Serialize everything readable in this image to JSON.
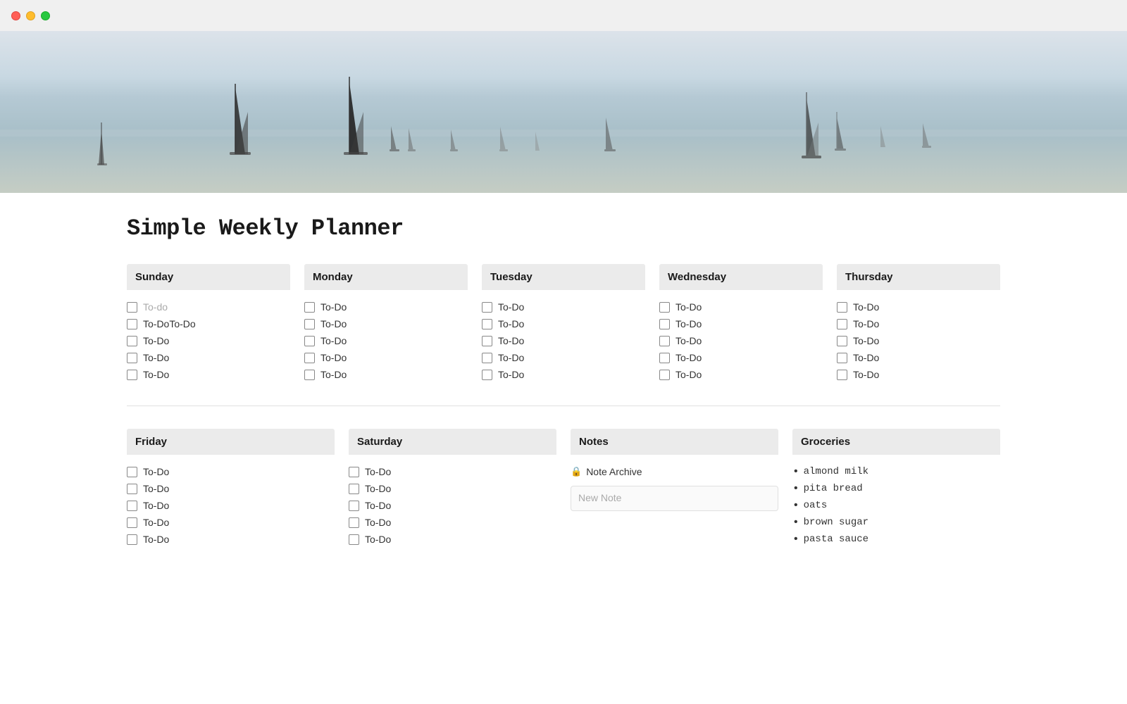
{
  "titlebar": {
    "lights": [
      "red",
      "yellow",
      "green"
    ]
  },
  "page": {
    "title": "Simple Weekly Planner"
  },
  "days": [
    {
      "name": "Sunday",
      "items": [
        {
          "text": "To-do",
          "placeholder": true
        },
        {
          "text": "To-DoTo-Do",
          "placeholder": false
        },
        {
          "text": "To-Do",
          "placeholder": false
        },
        {
          "text": "To-Do",
          "placeholder": false
        },
        {
          "text": "To-Do",
          "placeholder": false
        }
      ]
    },
    {
      "name": "Monday",
      "items": [
        {
          "text": "To-Do",
          "placeholder": false
        },
        {
          "text": "To-Do",
          "placeholder": false
        },
        {
          "text": "To-Do",
          "placeholder": false
        },
        {
          "text": "To-Do",
          "placeholder": false
        },
        {
          "text": "To-Do",
          "placeholder": false
        }
      ]
    },
    {
      "name": "Tuesday",
      "items": [
        {
          "text": "To-Do",
          "placeholder": false
        },
        {
          "text": "To-Do",
          "placeholder": false
        },
        {
          "text": "To-Do",
          "placeholder": false
        },
        {
          "text": "To-Do",
          "placeholder": false
        },
        {
          "text": "To-Do",
          "placeholder": false
        }
      ]
    },
    {
      "name": "Wednesday",
      "items": [
        {
          "text": "To-Do",
          "placeholder": false
        },
        {
          "text": "To-Do",
          "placeholder": false
        },
        {
          "text": "To-Do",
          "placeholder": false
        },
        {
          "text": "To-Do",
          "placeholder": false
        },
        {
          "text": "To-Do",
          "placeholder": false
        }
      ]
    },
    {
      "name": "Thursday",
      "items": [
        {
          "text": "To-Do",
          "placeholder": false
        },
        {
          "text": "To-Do",
          "placeholder": false
        },
        {
          "text": "To-Do",
          "placeholder": false
        },
        {
          "text": "To-Do",
          "placeholder": false
        },
        {
          "text": "To-Do",
          "placeholder": false
        }
      ]
    }
  ],
  "bottom_days": [
    {
      "name": "Friday",
      "items": [
        {
          "text": "To-Do"
        },
        {
          "text": "To-Do"
        },
        {
          "text": "To-Do"
        },
        {
          "text": "To-Do"
        },
        {
          "text": "To-Do"
        }
      ]
    },
    {
      "name": "Saturday",
      "items": [
        {
          "text": "To-Do"
        },
        {
          "text": "To-Do"
        },
        {
          "text": "To-Do"
        },
        {
          "text": "To-Do"
        },
        {
          "text": "To-Do"
        }
      ]
    }
  ],
  "notes": {
    "header": "Notes",
    "archive_label": "Note Archive",
    "new_note_placeholder": "New Note"
  },
  "groceries": {
    "header": "Groceries",
    "items": [
      "almond milk",
      "pita bread",
      "oats",
      "brown sugar",
      "pasta sauce"
    ]
  }
}
